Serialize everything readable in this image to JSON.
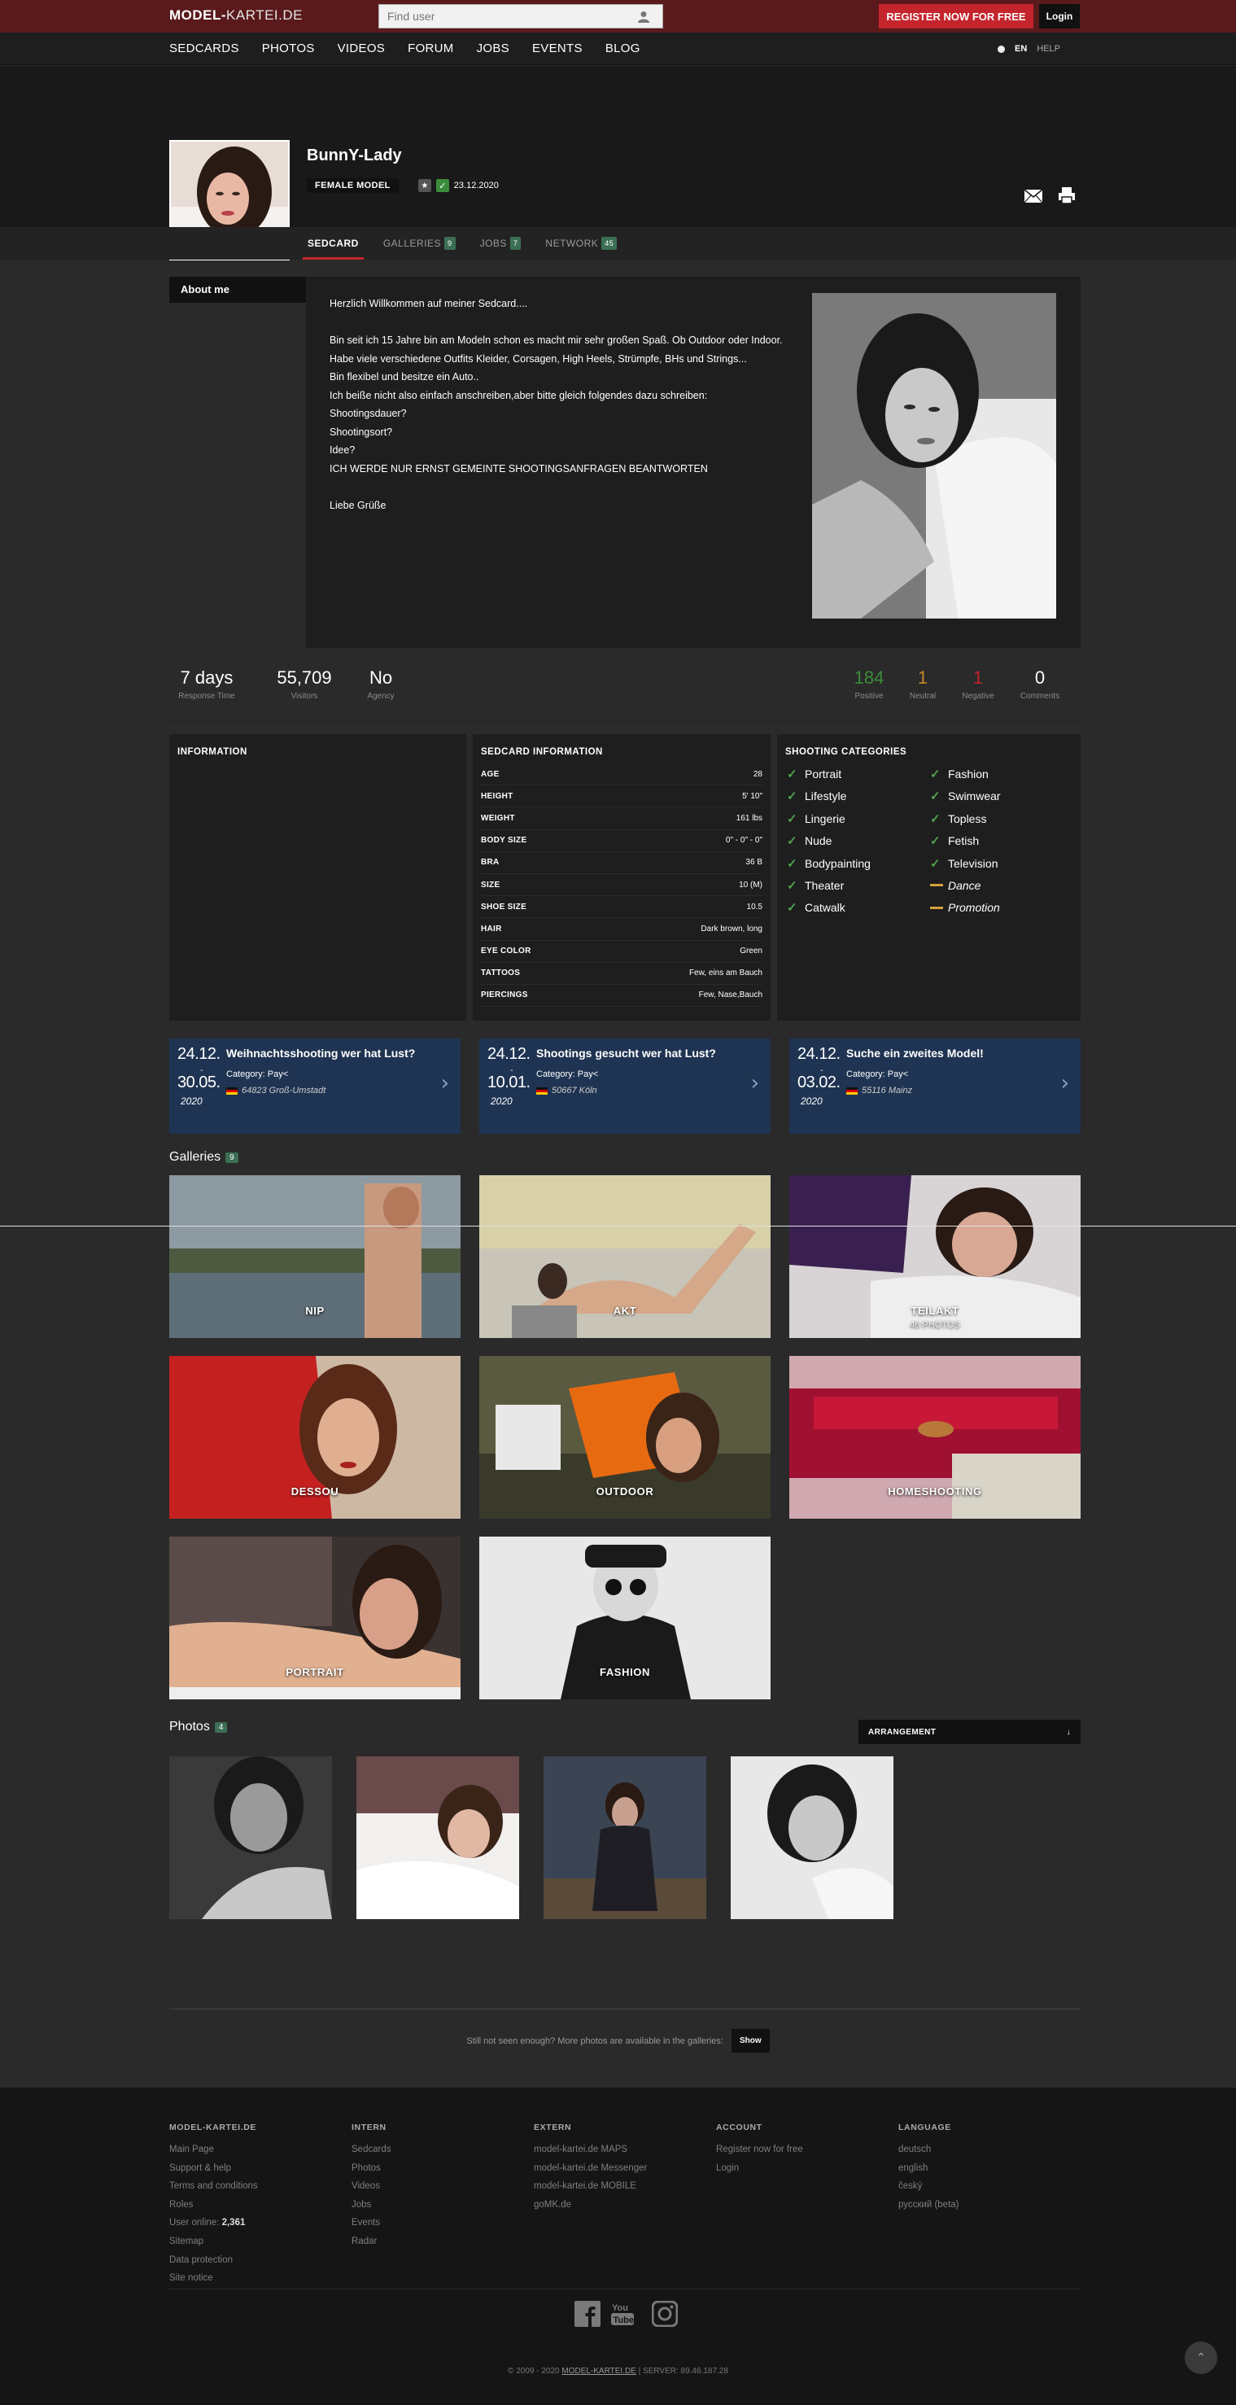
{
  "topbar": {
    "logo_brand": "MODEL-",
    "logo_rest": "KARTEI.DE",
    "search_placeholder": "Find user",
    "register_label": "REGISTER NOW FOR FREE",
    "login_label": "Login"
  },
  "nav": {
    "items": [
      "SEDCARDS",
      "PHOTOS",
      "VIDEOS",
      "FORUM",
      "JOBS",
      "EVENTS",
      "BLOG"
    ],
    "lang": "EN",
    "help": "HELP"
  },
  "profile": {
    "name": "BunnY-Lady",
    "type": "FEMALE MODEL",
    "star": "★",
    "verified_date": "23.12.2020"
  },
  "tabs": [
    {
      "label": "SEDCARD",
      "badge": ""
    },
    {
      "label": "GALLERIES",
      "badge": "9"
    },
    {
      "label": "JOBS",
      "badge": "7"
    },
    {
      "label": "NETWORK",
      "badge": "45"
    }
  ],
  "about": {
    "label": "About me",
    "lines": [
      "Herzlich Willkommen auf meiner Sedcard....",
      "",
      "Bin seit ich 15 Jahre bin am Modeln schon es macht mir sehr großen Spaß. Ob Outdoor oder Indoor.",
      "Habe viele verschiedene Outfits Kleider, Corsagen, High Heels, Strümpfe, BHs und Strings...",
      "Bin flexibel und besitze ein Auto..",
      "Ich beiße nicht also einfach anschreiben,aber bitte gleich folgendes dazu schreiben:",
      "Shootingsdauer?",
      "Shootingsort?",
      "Idee?",
      "ICH WERDE NUR ERNST GEMEINTE SHOOTINGSANFRAGEN BEANTWORTEN",
      "",
      "Liebe Grüße"
    ]
  },
  "stats": {
    "response": {
      "value": "7 days",
      "label": "Response Time"
    },
    "visitors": {
      "value": "55,709",
      "label": "Visitors"
    },
    "agency": {
      "value": "No",
      "label": "Agency"
    },
    "positive": {
      "value": "184",
      "label": "Positive",
      "color": "#3a8c3a"
    },
    "neutral": {
      "value": "1",
      "label": "Neutral",
      "color": "#c8862a"
    },
    "negative": {
      "value": "1",
      "label": "Negative",
      "color": "#c4242b"
    },
    "comments": {
      "value": "0",
      "label": "Comments",
      "color": "#ffffff"
    }
  },
  "information": {
    "title": "INFORMATION"
  },
  "sedcard": {
    "title": "SEDCARD INFORMATION",
    "rows": [
      {
        "k": "AGE",
        "v": "28"
      },
      {
        "k": "HEIGHT",
        "v": "5' 10\""
      },
      {
        "k": "WEIGHT",
        "v": "161 lbs"
      },
      {
        "k": "BODY SIZE",
        "v": "0\" - 0\" - 0\""
      },
      {
        "k": "BRA",
        "v": "36 B"
      },
      {
        "k": "SIZE",
        "v": "10 (M)"
      },
      {
        "k": "SHOE SIZE",
        "v": "10.5"
      },
      {
        "k": "HAIR",
        "v": "Dark brown, long"
      },
      {
        "k": "EYE COLOR",
        "v": "Green"
      },
      {
        "k": "TATTOOS",
        "v": "Few, eins am Bauch"
      },
      {
        "k": "PIERCINGS",
        "v": "Few, Nase,Bauch"
      }
    ]
  },
  "categories": {
    "title": "SHOOTING CATEGORIES",
    "items": [
      {
        "label": "Portrait",
        "mark": "check"
      },
      {
        "label": "Fashion",
        "mark": "check"
      },
      {
        "label": "Lifestyle",
        "mark": "check"
      },
      {
        "label": "Swimwear",
        "mark": "check"
      },
      {
        "label": "Lingerie",
        "mark": "check"
      },
      {
        "label": "Topless",
        "mark": "check"
      },
      {
        "label": "Nude",
        "mark": "check"
      },
      {
        "label": "Fetish",
        "mark": "check"
      },
      {
        "label": "Bodypainting",
        "mark": "check"
      },
      {
        "label": "Television",
        "mark": "check"
      },
      {
        "label": "Theater",
        "mark": "check"
      },
      {
        "label": "Dance",
        "mark": "dash"
      },
      {
        "label": "Catwalk",
        "mark": "check"
      },
      {
        "label": "Promotion",
        "mark": "dash"
      }
    ]
  },
  "jobs": [
    {
      "d1": "24.12.",
      "d2": "30.05.",
      "year": "2020",
      "title": "Weihnachtsshooting wer hat Lust?",
      "category": "Category: Pay<",
      "location": "64823 Groß-Umstadt"
    },
    {
      "d1": "24.12.",
      "d2": "10.01.",
      "year": "2020",
      "title": "Shootings gesucht wer hat Lust?",
      "category": "Category: Pay<",
      "location": "50667 Köln"
    },
    {
      "d1": "24.12.",
      "d2": "03.02.",
      "year": "2020",
      "title": "Suche ein zweites Model!",
      "category": "Category: Pay<",
      "location": "55116 Mainz"
    }
  ],
  "galleries": {
    "title": "Galleries",
    "count": "9",
    "items": [
      {
        "name": "NIP",
        "sub": ""
      },
      {
        "name": "AKT",
        "sub": ""
      },
      {
        "name": "TEILAKT",
        "sub": "46 PHOTOS"
      },
      {
        "name": "DESSOU",
        "sub": ""
      },
      {
        "name": "OUTDOOR",
        "sub": ""
      },
      {
        "name": "HOMESHOOTING",
        "sub": ""
      },
      {
        "name": "PORTRAIT",
        "sub": ""
      },
      {
        "name": "FASHION",
        "sub": ""
      }
    ]
  },
  "photos": {
    "title": "Photos",
    "count": "4",
    "arrangement": "ARRANGEMENT",
    "more_text": "Still not seen enough? More photos are available in the galleries:",
    "show_label": "Show"
  },
  "footer": {
    "cols": [
      {
        "head": "MODEL-KARTEI.DE",
        "links": [
          "Main Page",
          "Support & help",
          "Terms and conditions",
          "Roles",
          "User online:",
          "Sitemap",
          "Data protection",
          "Site notice"
        ],
        "online": "2,361"
      },
      {
        "head": "INTERN",
        "links": [
          "Sedcards",
          "Photos",
          "Videos",
          "Jobs",
          "Events",
          "Radar"
        ]
      },
      {
        "head": "EXTERN",
        "links": [
          "model-kartei.de MAPS",
          "model-kartei.de Messenger",
          "model-kartei.de MOBILE",
          "goMK.de"
        ]
      },
      {
        "head": "ACCOUNT",
        "links": [
          "Register now for free",
          "Login"
        ]
      },
      {
        "head": "LANGUAGE",
        "links": [
          "deutsch",
          "english",
          "český",
          "русский (beta)"
        ]
      }
    ],
    "copyright_pre": "© 2009 - 2020",
    "copyright_link": "MODEL-KARTEI.DE",
    "copyright_post": "| SERVER: 89.46.187.28"
  }
}
